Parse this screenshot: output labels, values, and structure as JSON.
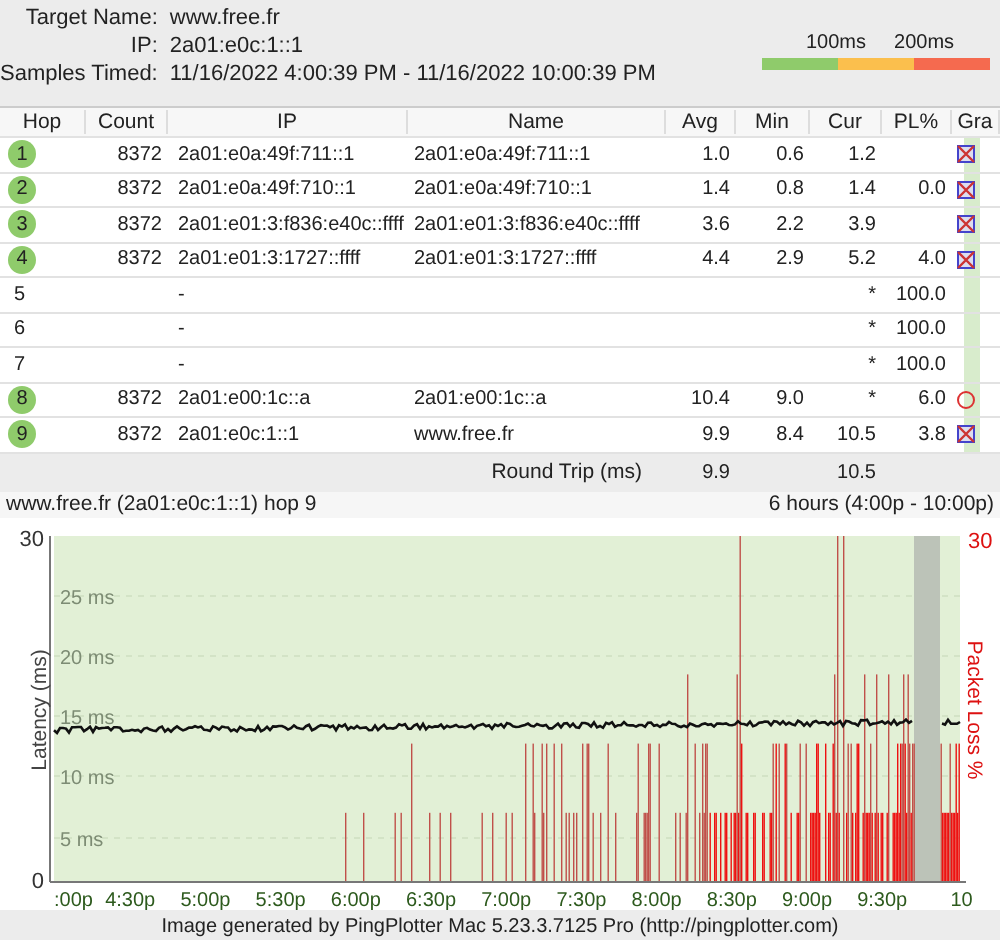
{
  "summary": [
    {
      "label": "Target Name:",
      "value": "www.free.fr"
    },
    {
      "label": "IP:",
      "value": "2a01:e0c:1::1"
    },
    {
      "label": "Samples Timed:",
      "value": "11/16/2022 4:00:39 PM - 11/16/2022 10:00:39 PM"
    }
  ],
  "legend": [
    {
      "label": "100ms",
      "color": "#8fcb6b"
    },
    {
      "label": "200ms",
      "color": "#fbbf4d"
    },
    {
      "color": "#f56a4f"
    }
  ],
  "table": {
    "columns": [
      "Hop",
      "Count",
      "IP",
      "Name",
      "Avg",
      "Min",
      "Cur",
      "PL%",
      "Gra"
    ],
    "rows": [
      {
        "hop": "1",
        "responding": true,
        "count": "8372",
        "ip": "2a01:e0a:49f:711::1",
        "name": "2a01:e0a:49f:711::1",
        "avg": "1.0",
        "min": "0.6",
        "cur": "1.2",
        "pl": "",
        "kind": "cross"
      },
      {
        "hop": "2",
        "responding": true,
        "count": "8372",
        "ip": "2a01:e0a:49f:710::1",
        "name": "2a01:e0a:49f:710::1",
        "avg": "1.4",
        "min": "0.8",
        "cur": "1.4",
        "pl": "0.0",
        "kind": "cross"
      },
      {
        "hop": "3",
        "responding": true,
        "count": "8372",
        "ip": "2a01:e01:3:f836:e40c::ffff",
        "name": "2a01:e01:3:f836:e40c::ffff",
        "avg": "3.6",
        "min": "2.2",
        "cur": "3.9",
        "pl": "",
        "kind": "cross"
      },
      {
        "hop": "4",
        "responding": true,
        "count": "8372",
        "ip": "2a01:e01:3:1727::ffff",
        "name": "2a01:e01:3:1727::ffff",
        "avg": "4.4",
        "min": "2.9",
        "cur": "5.2",
        "pl": "4.0",
        "kind": "cross"
      },
      {
        "hop": "5",
        "responding": false,
        "ip": "-",
        "cur": "*",
        "pl": "100.0"
      },
      {
        "hop": "6",
        "responding": false,
        "ip": "-",
        "cur": "*",
        "pl": "100.0"
      },
      {
        "hop": "7",
        "responding": false,
        "ip": "-",
        "cur": "*",
        "pl": "100.0"
      },
      {
        "hop": "8",
        "responding": true,
        "count": "8372",
        "ip": "2a01:e00:1c::a",
        "name": "2a01:e00:1c::a",
        "avg": "10.4",
        "min": "9.0",
        "cur": "*",
        "pl": "6.0",
        "kind": "circle"
      },
      {
        "hop": "9",
        "responding": true,
        "count": "8372",
        "ip": "2a01:e0c:1::1",
        "name": "www.free.fr",
        "avg": "9.9",
        "min": "8.4",
        "cur": "10.5",
        "pl": "3.8",
        "kind": "cross"
      }
    ],
    "round_trip": {
      "label": "Round Trip (ms)",
      "avg": "9.9",
      "cur": "10.5"
    }
  },
  "graph": {
    "title": "www.free.fr (2a01:e0c:1::1) hop 9",
    "range": "6 hours (4:00p - 10:00p)",
    "ylabel": "Latency (ms)",
    "y2label": "Packet Loss %",
    "left_ticks": [
      "30",
      "0"
    ],
    "right_ticks": [
      "30"
    ],
    "latency_ticks": [
      "25 ms",
      "20 ms",
      "15 ms",
      "10 ms",
      "5 ms"
    ],
    "xticks": [
      ":00p",
      "4:30p",
      "5:00p",
      "5:30p",
      "6:00p",
      "6:30p",
      "7:00p",
      "7:30p",
      "8:00p",
      "8:30p",
      "9:00p",
      "9:30p",
      "10"
    ]
  },
  "footer": "Image generated by PingPlotter Mac 5.23.3.7125 Pro (http://pingplotter.com)"
}
